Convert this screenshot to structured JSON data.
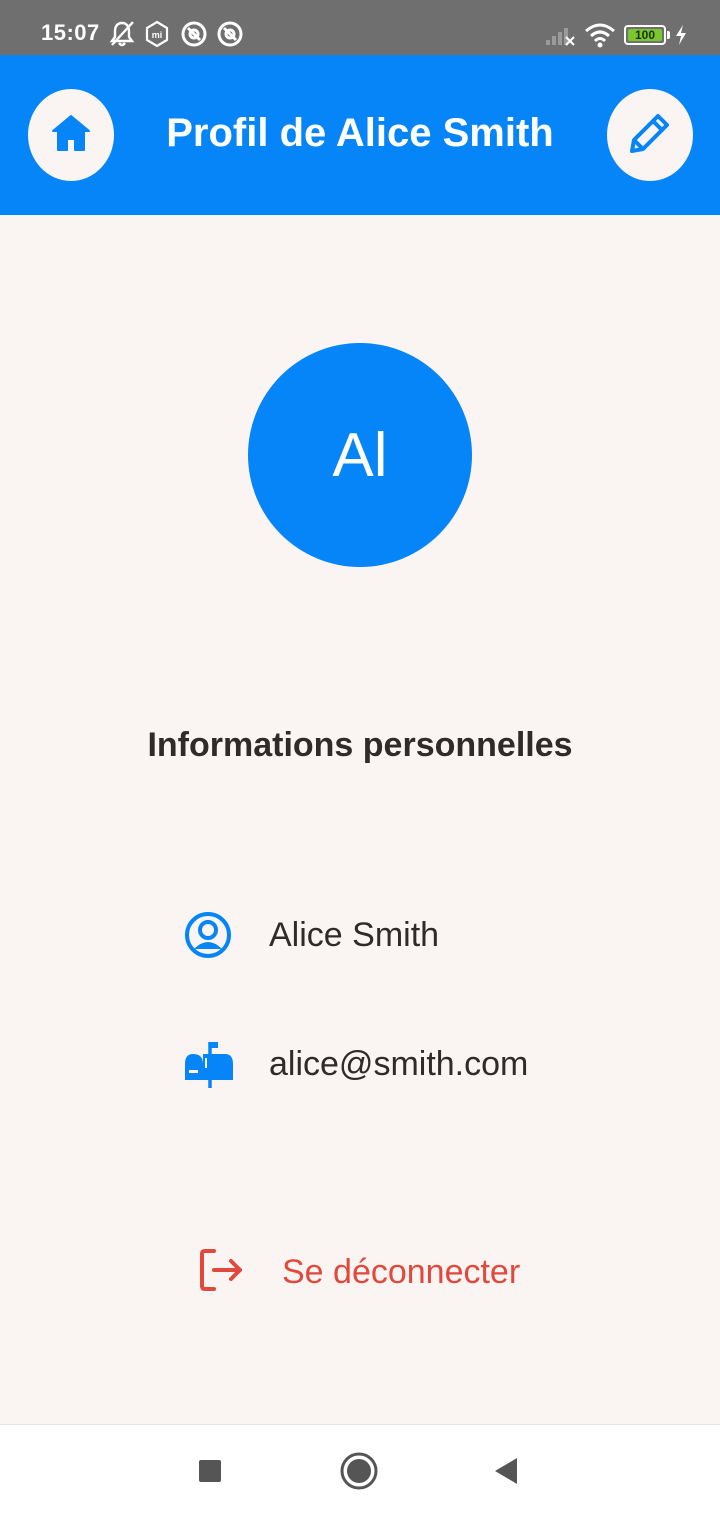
{
  "status_bar": {
    "time": "15:07",
    "battery": "100",
    "icons": [
      "bell-off-icon",
      "mi-icon",
      "app-notification-icon",
      "app-notification-icon",
      "signal-icon",
      "wifi-icon",
      "battery-icon",
      "charging-icon"
    ]
  },
  "app_bar": {
    "title": "Profil de Alice Smith",
    "home_icon": "home-icon",
    "edit_icon": "pencil-icon"
  },
  "profile": {
    "initials": "Al"
  },
  "section": {
    "title": "Informations personnelles"
  },
  "info": {
    "name": "Alice Smith",
    "email": "alice@smith.com"
  },
  "logout": {
    "label": "Se déconnecter"
  },
  "colors": {
    "primary": "#0585f7",
    "background": "#faf5f3",
    "danger": "#e0493b",
    "text": "#2e2b2a"
  }
}
